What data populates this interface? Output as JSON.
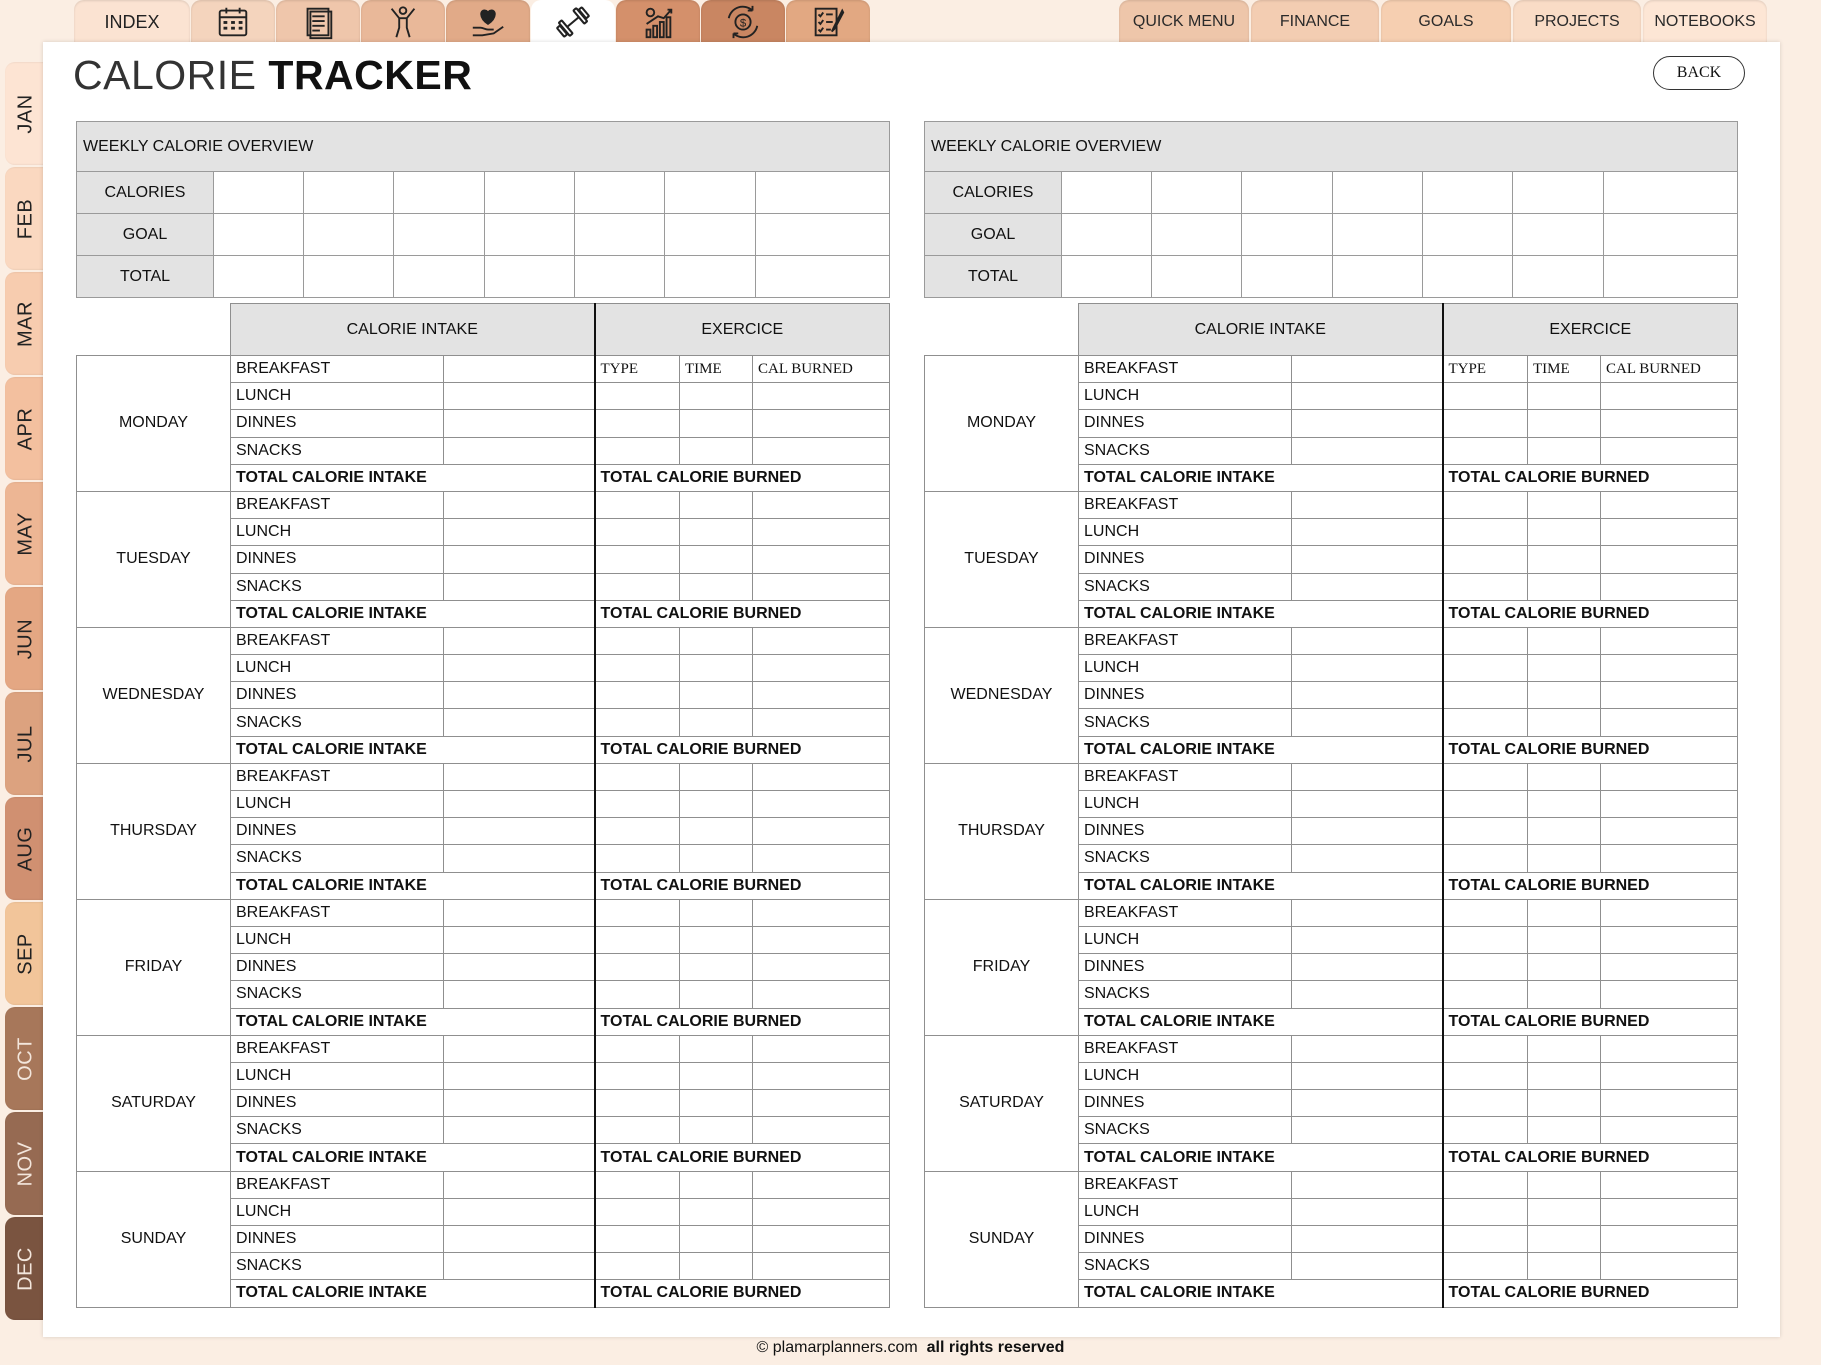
{
  "app": {
    "title_thin": "CALORIE",
    "title_bold": "TRACKER",
    "back_label": "BACK"
  },
  "top_tabs": [
    {
      "label": "INDEX",
      "color": "#fbe3d2"
    },
    {
      "icon": "calendar-icon",
      "color": "#f4d4bd"
    },
    {
      "icon": "notes-icon",
      "color": "#efc6ab"
    },
    {
      "icon": "wellness-figure-icon",
      "color": "#e9b899"
    },
    {
      "icon": "heart-hand-icon",
      "color": "#e1aa88"
    },
    {
      "icon": "dumbbell-icon",
      "color": "#ffffff"
    },
    {
      "icon": "growth-chart-icon",
      "color": "#d4906b"
    },
    {
      "icon": "money-exchange-icon",
      "color": "#c98662"
    },
    {
      "icon": "checklist-icon",
      "color": "#e2a882"
    }
  ],
  "right_tabs": [
    {
      "label": "QUICK MENU",
      "color": "#eec6aa"
    },
    {
      "label": "FINANCE",
      "color": "#f3cdb2"
    },
    {
      "label": "GOALS",
      "color": "#f6cfb1"
    },
    {
      "label": "PROJECTS",
      "color": "#f9dcc6"
    },
    {
      "label": "NOTEBOOKS",
      "color": "#fde6d5"
    }
  ],
  "months": [
    {
      "label": "JAN",
      "color": "#fde4d3"
    },
    {
      "label": "FEB",
      "color": "#fad8c0"
    },
    {
      "label": "MAR",
      "color": "#f7ccaf"
    },
    {
      "label": "APR",
      "color": "#f3c09f"
    },
    {
      "label": "MAY",
      "color": "#edb694"
    },
    {
      "label": "JUN",
      "color": "#e4a783"
    },
    {
      "label": "JUL",
      "color": "#dca27f"
    },
    {
      "label": "AUG",
      "color": "#d09071"
    },
    {
      "label": "SEP",
      "color": "#f2c59a"
    },
    {
      "label": "OCT",
      "color": "#a7775a"
    },
    {
      "label": "NOV",
      "color": "#966a52"
    },
    {
      "label": "DEC",
      "color": "#7a5440"
    }
  ],
  "weekly": {
    "title": "WEEKLY CALORIE OVERVIEW",
    "rows": [
      "CALORIES",
      "GOAL",
      "TOTAL"
    ]
  },
  "headers": {
    "intake": "CALORIE INTAKE",
    "exercise": "EXERCICE",
    "type": "TYPE",
    "time": "TIME",
    "cal_burned": "CAL BURNED"
  },
  "meals": [
    "BREAKFAST",
    "LUNCH",
    "DINNES",
    "SNACKS"
  ],
  "totals": {
    "intake": "TOTAL CALORIE INTAKE",
    "burned": "TOTAL CALORIE BURNED"
  },
  "days": [
    "MONDAY",
    "TUESDAY",
    "WEDNESDAY",
    "THURSDAY",
    "FRIDAY",
    "SATURDAY",
    "SUNDAY"
  ],
  "footer": {
    "site": "© plamarplanners.com",
    "rights": "all rights reserved"
  }
}
